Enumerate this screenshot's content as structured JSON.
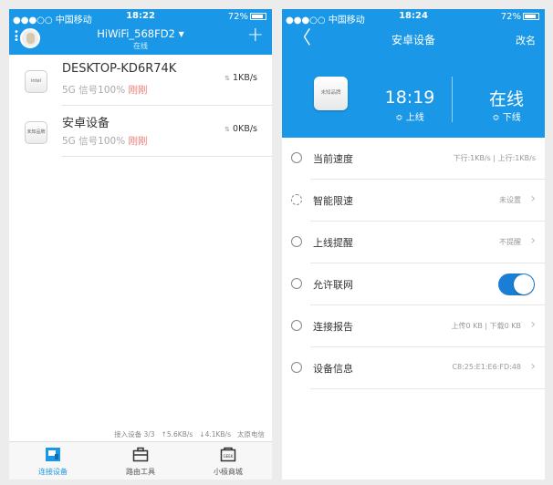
{
  "status_left": {
    "carrier": "●●●○○ 中国移动",
    "time": "18:22",
    "battery": "72%"
  },
  "status_right": {
    "carrier": "●●●○○ 中国移动",
    "time": "18:24",
    "battery": "72%"
  },
  "left_screen": {
    "router_name": "HiWiFi_568FD2",
    "router_status": "在线",
    "devices": [
      {
        "name": "DESKTOP-KD6R74K",
        "band": "5G 信号100%",
        "seen": "刚刚",
        "speed": "1KB/s",
        "icon_text": "intel"
      },
      {
        "name": "安卓设备",
        "band": "5G 信号100%",
        "seen": "刚刚",
        "speed": "0KB/s",
        "icon_text": "未知品牌"
      }
    ],
    "footer": {
      "count": "接入设备 3/3",
      "up": "↑5.6KB/s",
      "down": "↓4.1KB/s",
      "isp": "太原电信"
    },
    "tabs": [
      {
        "label": "连接设备",
        "icon": "devices-icon"
      },
      {
        "label": "路由工具",
        "icon": "toolbox-icon"
      },
      {
        "label": "小极商城",
        "icon": "geek-shop-icon"
      }
    ]
  },
  "right_screen": {
    "title": "安卓设备",
    "rename": "改名",
    "brand": "未知品牌",
    "online_time": "18:19",
    "online_time_label": "上线",
    "state": "在线",
    "state_label": "下线",
    "rows": [
      {
        "label": "当前速度",
        "value": "下行:1KB/s | 上行:1KB/s",
        "icon": "speed-icon"
      },
      {
        "label": "智能限速",
        "value": "未设置",
        "icon": "limit-icon"
      },
      {
        "label": "上线提醒",
        "value": "不提醒",
        "icon": "alarm-icon"
      },
      {
        "label": "允许联网",
        "value": "",
        "icon": "globe-icon",
        "toggle": true
      },
      {
        "label": "连接报告",
        "value": "上传0 KB | 下载0 KB",
        "icon": "report-icon"
      },
      {
        "label": "设备信息",
        "value": "C8:25:E1:E6:FD:48",
        "icon": "info-icon"
      }
    ]
  },
  "colors": {
    "accent": "#1a98e7",
    "toggle_on": "#1a7fd4",
    "recent": "#f07a72"
  }
}
